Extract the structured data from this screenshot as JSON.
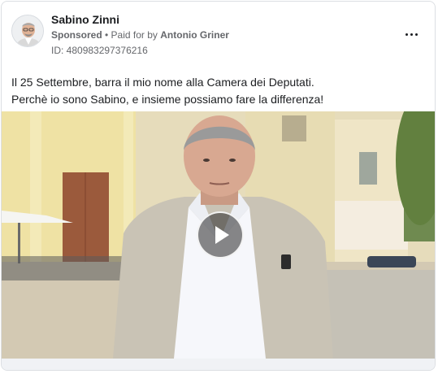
{
  "post": {
    "page_name": "Sabino Zinni",
    "sponsored_label": "Sponsored",
    "separator": " • ",
    "paid_for_prefix": "Paid for by ",
    "payer": "Antonio Griner",
    "ad_id": "ID: 480983297376216",
    "text_line1": "Il 25 Settembre, barra il mio nome alla Camera dei Deputati.",
    "text_line2": "Perchè io sono Sabino, e insieme possiamo fare la differenza!"
  },
  "icons": {
    "more": "more-options-icon",
    "play": "play-icon",
    "avatar": "avatar"
  },
  "colors": {
    "text_primary": "#1c1e21",
    "text_secondary": "#65676b",
    "card_border": "#dcdfe3"
  }
}
